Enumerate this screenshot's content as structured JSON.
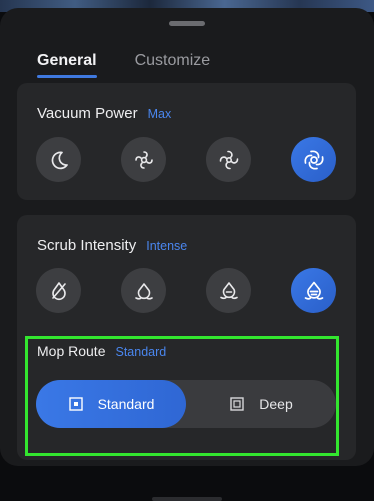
{
  "tabs": [
    {
      "label": "General",
      "active": true
    },
    {
      "label": "Customize",
      "active": false
    }
  ],
  "vacuum_power": {
    "title": "Vacuum Power",
    "value": "Max",
    "options": [
      "quiet-icon",
      "standard-suction-icon",
      "turbo-suction-icon",
      "max-suction-icon"
    ],
    "selected_index": 3
  },
  "scrub_intensity": {
    "title": "Scrub Intensity",
    "value": "Intense",
    "options": [
      "no-water-icon",
      "mild-water-icon",
      "moderate-water-icon",
      "intense-water-icon"
    ],
    "selected_index": 3
  },
  "mop_route": {
    "title": "Mop Route",
    "value": "Standard",
    "options": [
      {
        "label": "Standard",
        "icon": "standard-route-icon",
        "selected": true
      },
      {
        "label": "Deep",
        "icon": "deep-route-icon",
        "selected": false
      }
    ]
  },
  "colors": {
    "accent": "#3f79e0",
    "highlight": "#33e62f",
    "card": "#262729",
    "sheet": "#1a1b1d"
  }
}
